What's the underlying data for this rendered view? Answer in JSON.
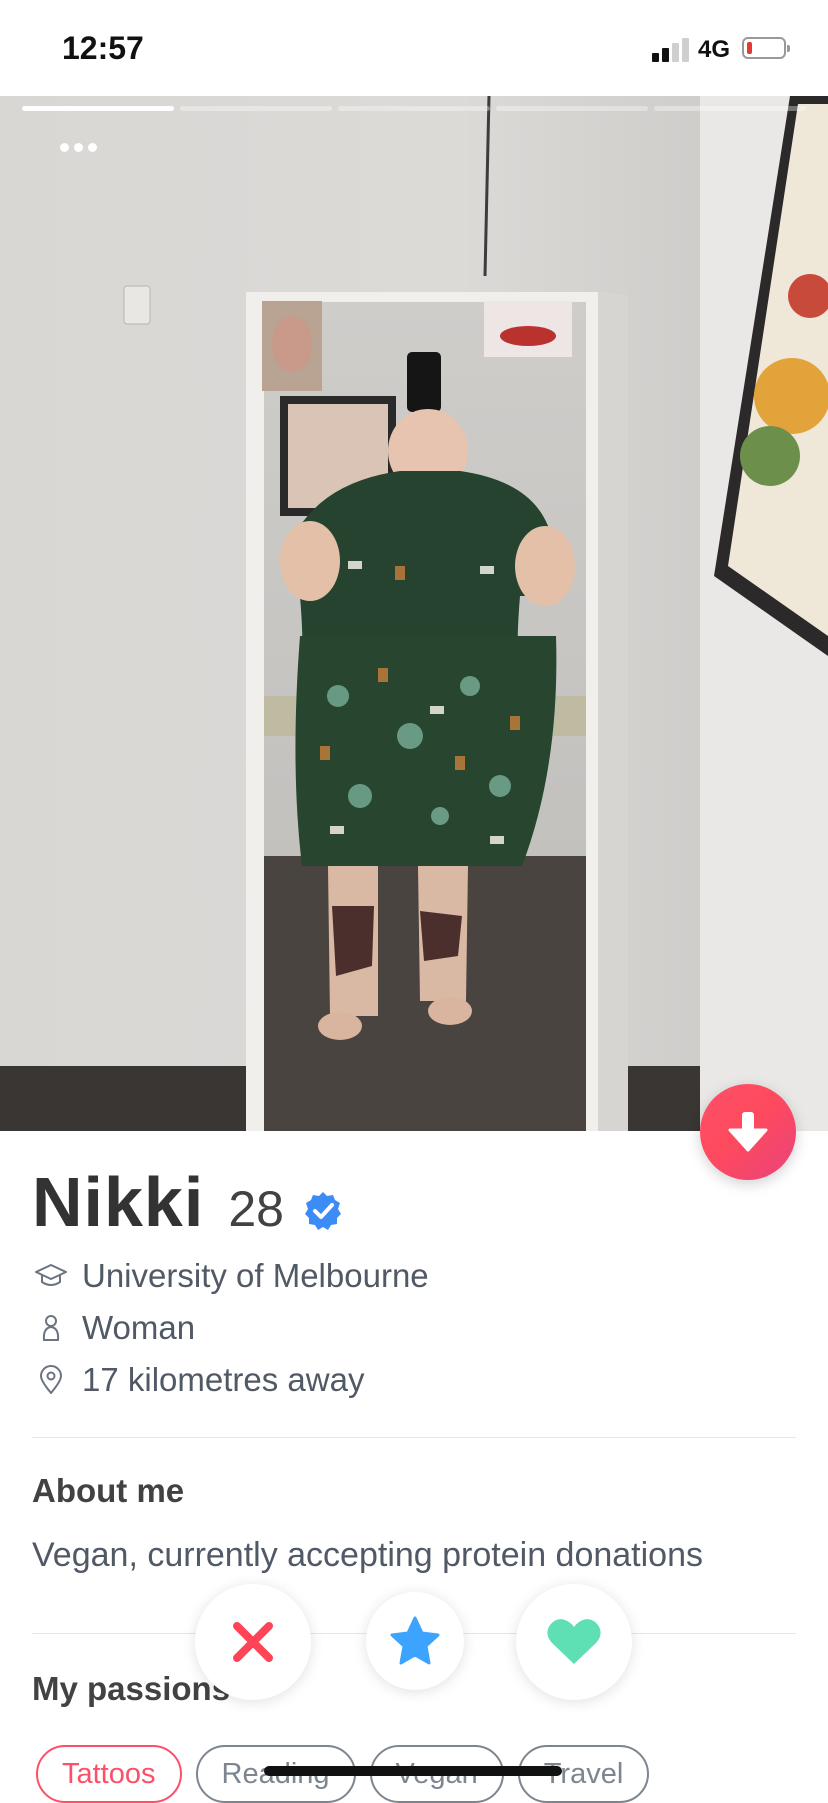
{
  "status_bar": {
    "time": "12:57",
    "network": "4G",
    "signal_bars_active": 2,
    "battery_level": "low"
  },
  "photo_carousel": {
    "photo_count": 5,
    "current_index": 1,
    "more_icon": "ellipsis-icon"
  },
  "profile": {
    "name": "Nikki",
    "age": "28",
    "verified_icon": "verified-badge-icon",
    "school": "University of Melbourne",
    "gender": "Woman",
    "distance": "17 kilometres away"
  },
  "about": {
    "title": "About me",
    "text": "Vegan, currently accepting protein donations"
  },
  "passions": {
    "title": "My passions",
    "items": [
      {
        "label": "Tattoos",
        "selected": true
      },
      {
        "label": "Reading",
        "selected": false
      },
      {
        "label": "Vegan",
        "selected": false
      },
      {
        "label": "Travel",
        "selected": false
      }
    ]
  },
  "actions": {
    "nope": "close-icon",
    "super_like": "star-icon",
    "like": "heart-icon"
  },
  "colors": {
    "brand": "#fd5068",
    "verified": "#3d8cf5",
    "star": "#3ca4ff",
    "like": "#5ee0b4",
    "nope": "#ff4458",
    "text": "#505965"
  }
}
